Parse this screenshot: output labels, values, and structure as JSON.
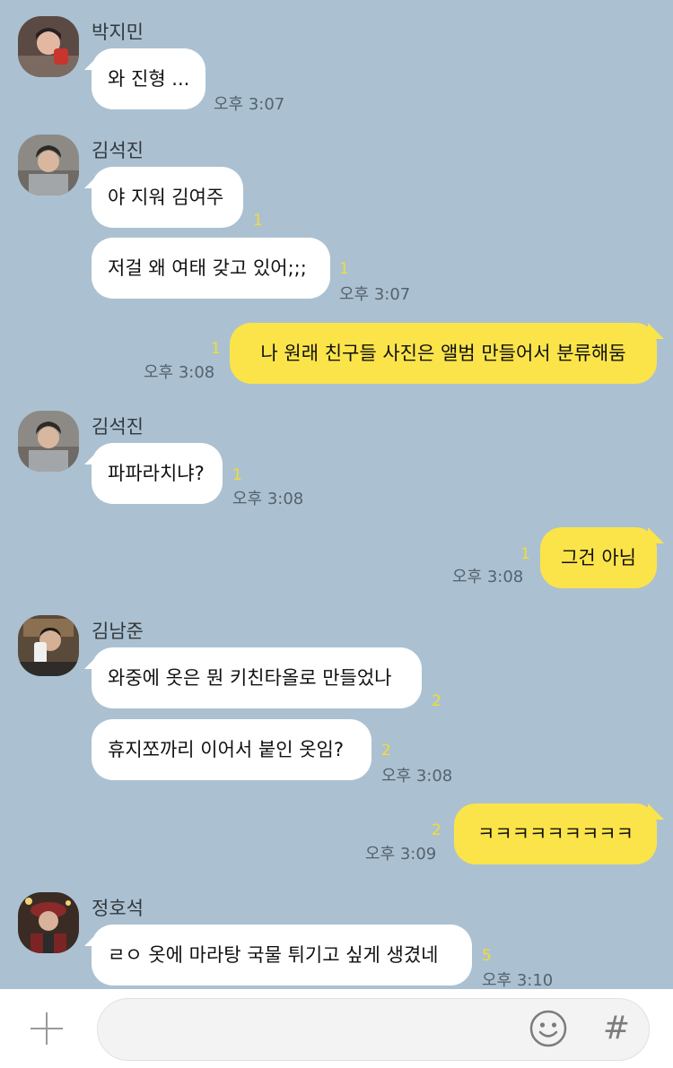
{
  "messages": [
    {
      "sender": "박지민",
      "text": "와 진형 ...",
      "unread": "",
      "time": "오후 3:07"
    },
    {
      "sender": "김석진",
      "text": "야 지워 김여주",
      "unread": "1",
      "time": ""
    },
    {
      "sender": "",
      "text": "저걸 왜 여태 갖고 있어;;;",
      "unread": "1",
      "time": "오후 3:07"
    },
    {
      "sender": "me",
      "text": "나 원래 친구들 사진은 앨범 만들어서 분류해둠",
      "unread": "1",
      "time": "오후 3:08"
    },
    {
      "sender": "김석진",
      "text": "파파라치냐?",
      "unread": "1",
      "time": "오후 3:08"
    },
    {
      "sender": "me",
      "text": "그건 아님",
      "unread": "1",
      "time": "오후 3:08"
    },
    {
      "sender": "김남준",
      "text": "와중에 옷은 뭔 키친타올로 만들었나",
      "unread": "2",
      "time": ""
    },
    {
      "sender": "",
      "text": "휴지쪼까리 이어서 붙인 옷임?",
      "unread": "2",
      "time": "오후 3:08"
    },
    {
      "sender": "me",
      "text": "ㅋㅋㅋㅋㅋㅋㅋㅋㅋ",
      "unread": "2",
      "time": "오후 3:09"
    },
    {
      "sender": "정호석",
      "text": "ㄹㅇ 옷에 마라탕 국물 튀기고 싶게 생겼네",
      "unread": "5",
      "time": "오후 3:10"
    }
  ],
  "input_bar": {
    "placeholder": "",
    "icons": [
      "plus-icon",
      "emoji-icon",
      "hashtag-icon"
    ],
    "hash_glyph": "#"
  },
  "colors": {
    "background": "#abc1d1",
    "incoming_bubble": "#ffffff",
    "outgoing_bubble": "#fbe44a",
    "unread_count": "#f4dc31"
  }
}
